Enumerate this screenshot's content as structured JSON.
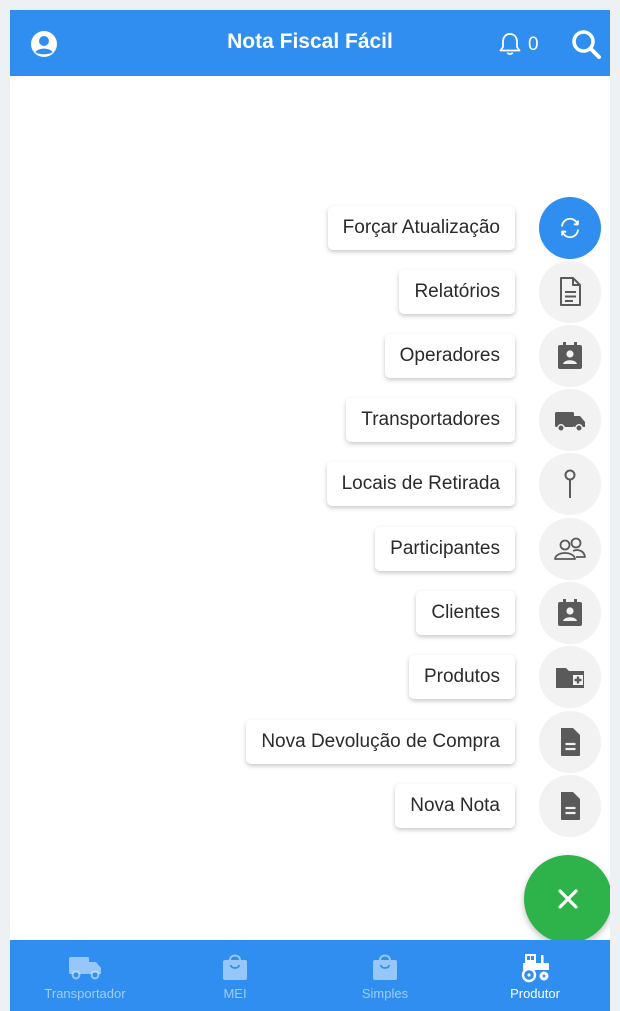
{
  "header": {
    "title": "Nota Fiscal Fácil",
    "notification_count": "0"
  },
  "menu": [
    {
      "label": "Forçar Atualização",
      "icon": "refresh-icon"
    },
    {
      "label": "Relatórios",
      "icon": "document-icon"
    },
    {
      "label": "Operadores",
      "icon": "contact-card-icon"
    },
    {
      "label": "Transportadores",
      "icon": "truck-icon"
    },
    {
      "label": "Locais de Retirada",
      "icon": "pin-icon"
    },
    {
      "label": "Participantes",
      "icon": "people-icon"
    },
    {
      "label": "Clientes",
      "icon": "contact-card-icon"
    },
    {
      "label": "Produtos",
      "icon": "folder-plus-icon"
    },
    {
      "label": "Nova Devolução de Compra",
      "icon": "file-icon"
    },
    {
      "label": "Nova Nota",
      "icon": "file-icon"
    }
  ],
  "bottom_nav": [
    {
      "label": "Transportador",
      "icon": "truck-icon"
    },
    {
      "label": "MEI",
      "icon": "shopping-bag-icon"
    },
    {
      "label": "Simples",
      "icon": "shopping-bag-icon"
    },
    {
      "label": "Produtor",
      "icon": "tractor-icon"
    }
  ],
  "colors": {
    "brand": "#2f8ef0",
    "close_fab": "#2db34a",
    "icon_gray": "#5a5a5a"
  }
}
